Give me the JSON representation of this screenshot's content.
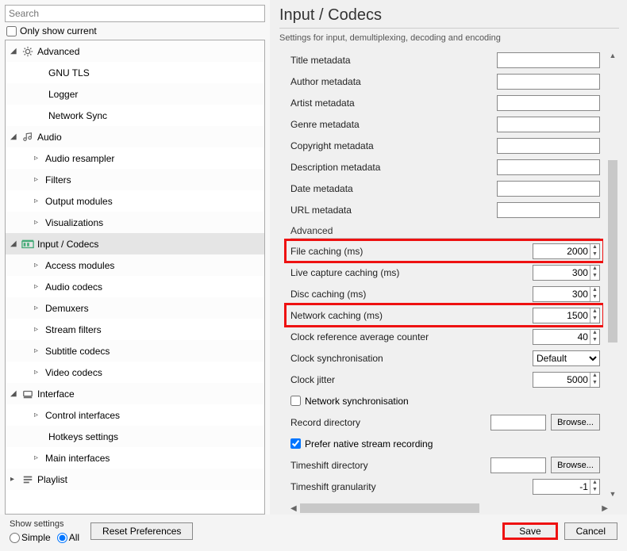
{
  "search_placeholder": "Search",
  "only_current": "Only show current",
  "tree": [
    {
      "type": "cat",
      "label": "Advanced",
      "icon": "gear",
      "expanded": true
    },
    {
      "type": "child",
      "label": "GNU TLS"
    },
    {
      "type": "child",
      "label": "Logger"
    },
    {
      "type": "child",
      "label": "Network Sync"
    },
    {
      "type": "cat",
      "label": "Audio",
      "icon": "audio",
      "expanded": true
    },
    {
      "type": "sub",
      "label": "Audio resampler"
    },
    {
      "type": "sub",
      "label": "Filters"
    },
    {
      "type": "sub",
      "label": "Output modules"
    },
    {
      "type": "sub",
      "label": "Visualizations"
    },
    {
      "type": "cat",
      "label": "Input / Codecs",
      "icon": "codec",
      "expanded": true,
      "selected": true
    },
    {
      "type": "sub",
      "label": "Access modules"
    },
    {
      "type": "sub",
      "label": "Audio codecs"
    },
    {
      "type": "sub",
      "label": "Demuxers"
    },
    {
      "type": "sub",
      "label": "Stream filters"
    },
    {
      "type": "sub",
      "label": "Subtitle codecs"
    },
    {
      "type": "sub",
      "label": "Video codecs"
    },
    {
      "type": "cat",
      "label": "Interface",
      "icon": "interface",
      "expanded": true
    },
    {
      "type": "sub",
      "label": "Control interfaces"
    },
    {
      "type": "child",
      "label": "Hotkeys settings"
    },
    {
      "type": "sub",
      "label": "Main interfaces"
    },
    {
      "type": "cat",
      "label": "Playlist",
      "icon": "playlist",
      "expanded": false
    }
  ],
  "page_title": "Input / Codecs",
  "page_subtitle": "Settings for input, demultiplexing, decoding and encoding",
  "meta_fields": [
    "Title metadata",
    "Author metadata",
    "Artist metadata",
    "Genre metadata",
    "Copyright metadata",
    "Description metadata",
    "Date metadata",
    "URL metadata"
  ],
  "adv_header": "Advanced",
  "adv": {
    "file_caching": {
      "label": "File caching (ms)",
      "value": "2000"
    },
    "live_caching": {
      "label": "Live capture caching (ms)",
      "value": "300"
    },
    "disc_caching": {
      "label": "Disc caching (ms)",
      "value": "300"
    },
    "net_caching": {
      "label": "Network caching (ms)",
      "value": "1500"
    },
    "clock_avg": {
      "label": "Clock reference average counter",
      "value": "40"
    },
    "clock_sync": {
      "label": "Clock synchronisation",
      "value": "Default"
    },
    "clock_jitter": {
      "label": "Clock jitter",
      "value": "5000"
    },
    "net_sync": {
      "label": "Network synchronisation",
      "checked": false
    },
    "record_dir": {
      "label": "Record directory",
      "value": "",
      "browse": "Browse..."
    },
    "prefer_native": {
      "label": "Prefer native stream recording",
      "checked": true
    },
    "timeshift_dir": {
      "label": "Timeshift directory",
      "value": "",
      "browse": "Browse..."
    },
    "timeshift_gran": {
      "label": "Timeshift granularity",
      "value": "-1"
    }
  },
  "bottom": {
    "show_settings": "Show settings",
    "simple": "Simple",
    "all": "All",
    "reset": "Reset Preferences",
    "save": "Save",
    "cancel": "Cancel"
  }
}
